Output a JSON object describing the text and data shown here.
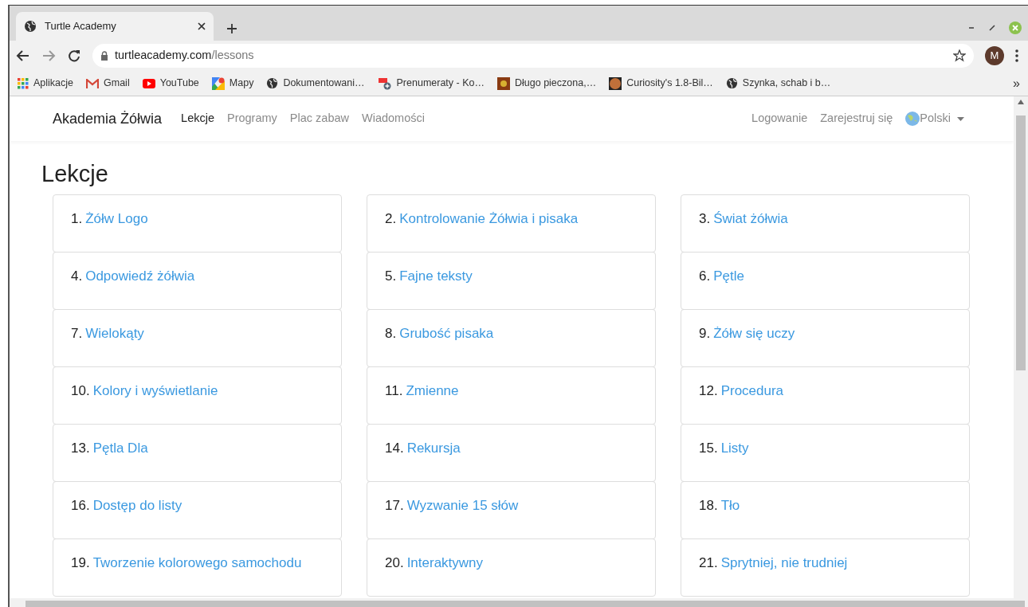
{
  "browser": {
    "tab": {
      "title": "Turtle Academy"
    },
    "address": {
      "host": "turtleacademy.com",
      "path": "/lessons"
    },
    "profile": "M",
    "bookmarks": [
      {
        "label": "Aplikacje",
        "kind": "apps"
      },
      {
        "label": "Gmail",
        "kind": "gmail"
      },
      {
        "label": "YouTube",
        "kind": "youtube"
      },
      {
        "label": "Mapy",
        "kind": "maps"
      },
      {
        "label": "Dokumentowani…",
        "kind": "globe"
      },
      {
        "label": "Prenumeraty - Ko…",
        "kind": "feed"
      },
      {
        "label": "Długo pieczona,…",
        "kind": "photo"
      },
      {
        "label": "Curiosity's 1.8-Bil…",
        "kind": "planet"
      },
      {
        "label": "Szynka, schab i b…",
        "kind": "globe"
      }
    ],
    "more": "»"
  },
  "navbar": {
    "brand": "Akademia Żółwia",
    "items": [
      {
        "label": "Lekcje",
        "selected": true
      },
      {
        "label": "Programy",
        "selected": false
      },
      {
        "label": "Plac zabaw",
        "selected": false
      },
      {
        "label": "Wiadomości",
        "selected": false
      }
    ],
    "right": [
      {
        "label": "Logowanie",
        "kind": "link"
      },
      {
        "label": "Zarejestruj się",
        "kind": "link"
      },
      {
        "label": "Polski",
        "kind": "language"
      }
    ]
  },
  "heading": "Lekcje",
  "lessons": [
    {
      "number": "1.",
      "title": "Żółw Logo"
    },
    {
      "number": "2.",
      "title": "Kontrolowanie Żółwia i pisaka"
    },
    {
      "number": "3.",
      "title": "Świat żółwia"
    },
    {
      "number": "4.",
      "title": "Odpowiedź żółwia"
    },
    {
      "number": "5.",
      "title": "Fajne teksty"
    },
    {
      "number": "6.",
      "title": "Pętle"
    },
    {
      "number": "7.",
      "title": "Wielokąty"
    },
    {
      "number": "8.",
      "title": "Grubość pisaka"
    },
    {
      "number": "9.",
      "title": "Żółw się uczy"
    },
    {
      "number": "10.",
      "title": "Kolory i wyświetlanie"
    },
    {
      "number": "11.",
      "title": "Zmienne"
    },
    {
      "number": "12.",
      "title": "Procedura"
    },
    {
      "number": "13.",
      "title": "Pętla Dla"
    },
    {
      "number": "14.",
      "title": "Rekursja"
    },
    {
      "number": "15.",
      "title": "Listy"
    },
    {
      "number": "16.",
      "title": "Dostęp do listy"
    },
    {
      "number": "17.",
      "title": "Wyzwanie 15 słów"
    },
    {
      "number": "18.",
      "title": "Tło"
    },
    {
      "number": "19.",
      "title": "Tworzenie kolorowego samochodu"
    },
    {
      "number": "20.",
      "title": "Interaktywny"
    },
    {
      "number": "21.",
      "title": "Sprytniej, nie trudniej"
    }
  ]
}
